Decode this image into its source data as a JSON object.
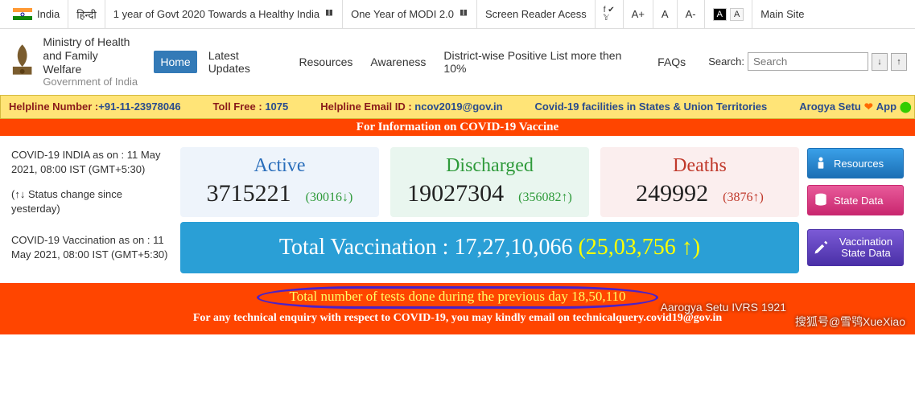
{
  "topbar": {
    "country": "India",
    "lang": "हिन्दी",
    "link1": "1 year of Govt 2020 Towards a Healthy India",
    "link2": "One Year of MODI 2.0",
    "access": "Screen Reader Acess",
    "aplus": "A+",
    "anorm": "A",
    "aminus": "A-",
    "ainv": "A",
    "ainv2": "A",
    "main": "Main Site"
  },
  "ministry": {
    "l1": "Ministry of Health",
    "l2": "and Family Welfare",
    "l3": "Government of India"
  },
  "nav": {
    "home": "Home",
    "latest": "Latest Updates",
    "resources": "Resources",
    "awareness": "Awareness",
    "district": "District-wise Positive List more then 10%",
    "faqs": "FAQs",
    "searchlbl": "Search:",
    "placeholder": "Search"
  },
  "yellow": {
    "helpline_lbl": "Helpline Number :",
    "helpline_val": "+91-11-23978046",
    "toll_lbl": "Toll Free :",
    "toll_val": "1075",
    "email_lbl": "Helpline Email ID :",
    "email_val": "ncov2019@gov.in",
    "facilities": "Covid-19 facilities in States & Union Territories",
    "arogya": "Arogya Setu",
    "app": "App"
  },
  "orange_top": "For Information on COVID-19 Vaccine",
  "leftinfo": {
    "asof": "COVID-19 INDIA as on : 11 May 2021, 08:00 IST (GMT+5:30)",
    "status": "(↑↓ Status change since yesterday)",
    "vacc_asof": "COVID-19 Vaccination as on : 11 May 2021, 08:00 IST (GMT+5:30)"
  },
  "cards": {
    "active": {
      "title": "Active",
      "value": "3715221",
      "delta": "(30016↓)"
    },
    "discharged": {
      "title": "Discharged",
      "value": "19027304",
      "delta": "(356082↑)"
    },
    "deaths": {
      "title": "Deaths",
      "value": "249992",
      "delta": "(3876↑)"
    }
  },
  "rbtn": {
    "resources": "Resources",
    "state": "State Data",
    "vacc": "Vaccination State Data"
  },
  "vacc": {
    "label": "Total Vaccination : ",
    "value": "17,27,10,066",
    "delta": "(25,03,756 ↑)"
  },
  "bottom": {
    "tests": "Total number of tests done during the previous day 18,50,110",
    "tech": "For any technical enquiry with respect to COVID-19, you may kindly email on technicalquery.covid19@gov.in",
    "ivrs": "Aarogya Setu IVRS   1921"
  },
  "watermark": "搜狐号@雪鸮XueXiao"
}
